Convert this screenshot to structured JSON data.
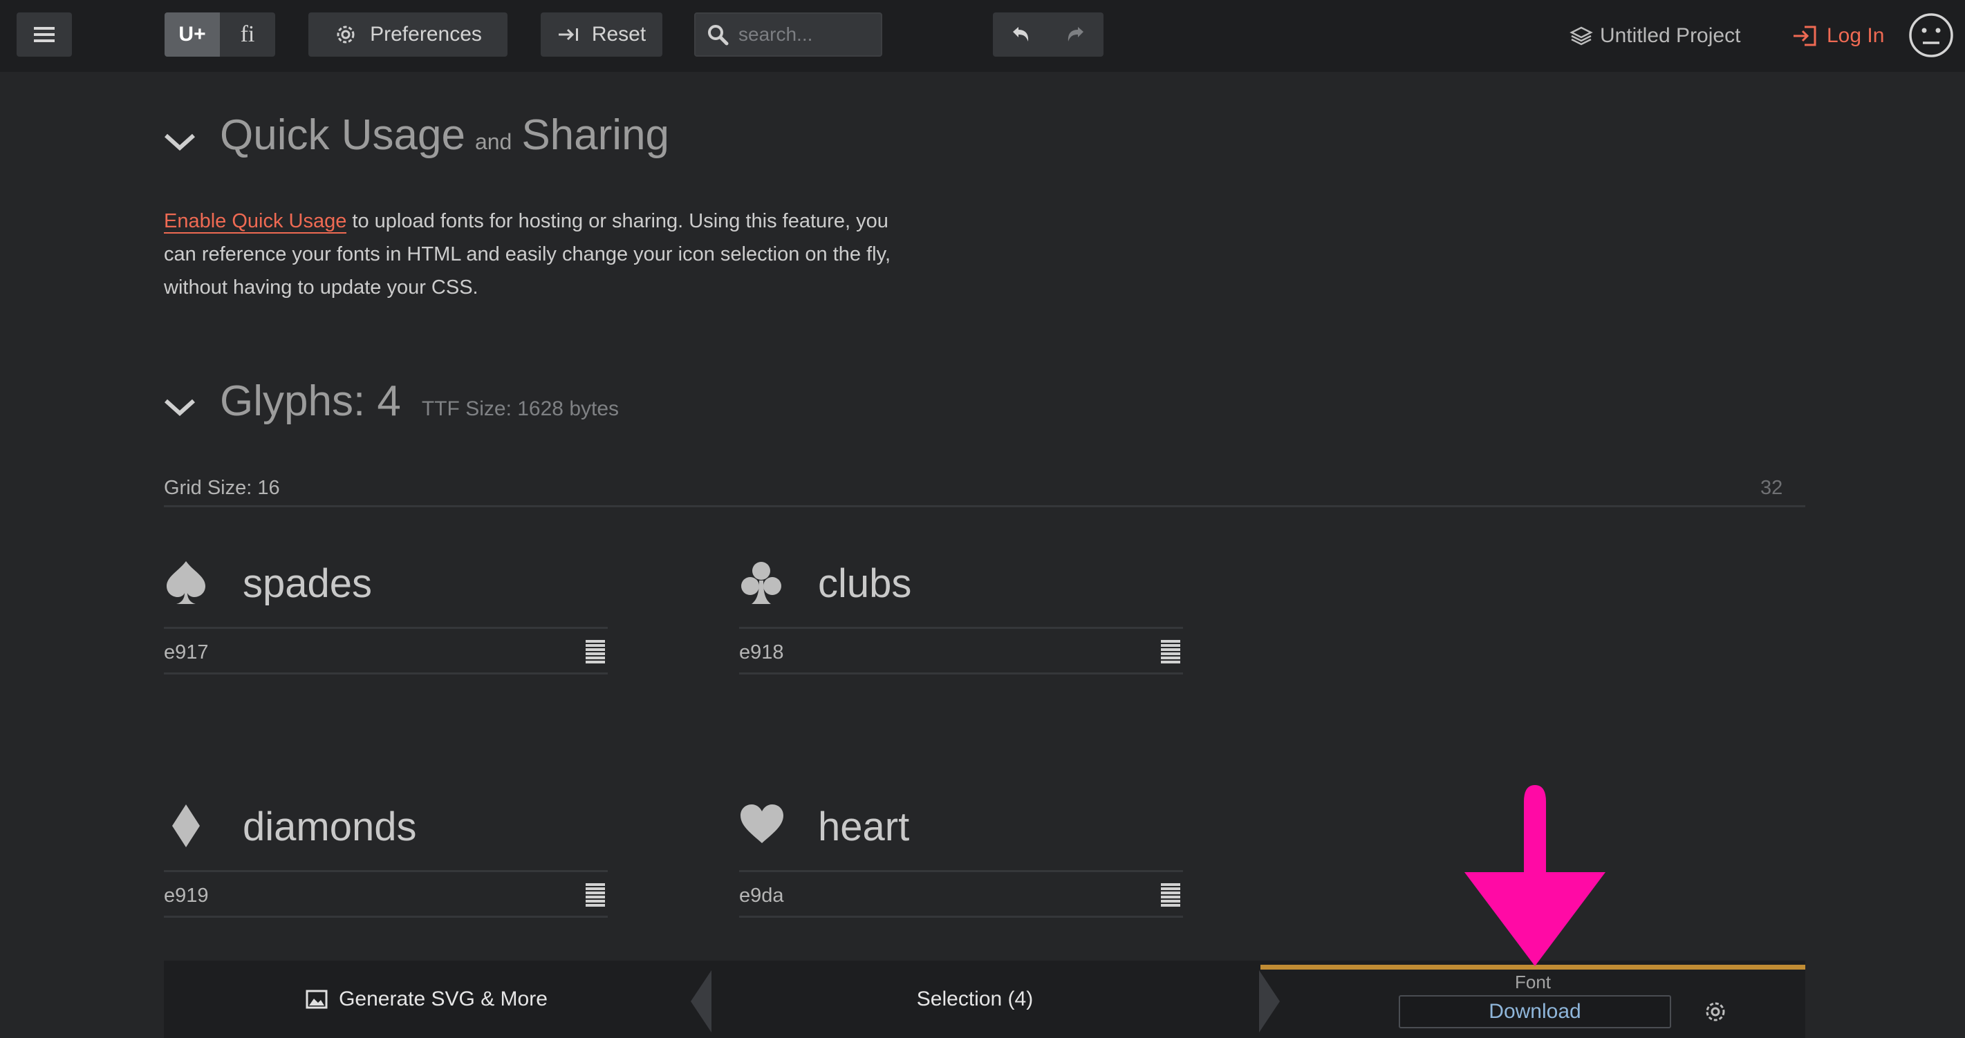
{
  "toolbar": {
    "unicode_label": "U+",
    "ligature_label": "fi",
    "preferences_label": "Preferences",
    "reset_label": "Reset",
    "search_placeholder": "search...",
    "project_title": "Untitled Project",
    "login_label": "Log In"
  },
  "quick_usage": {
    "title_part1": "Quick Usage",
    "title_and": "and",
    "title_part2": "Sharing",
    "link_text": "Enable Quick Usage",
    "body_text": " to upload fonts for hosting or sharing. Using this feature, you can reference your fonts in HTML and easily change your icon selection on the fly, without having to update your CSS."
  },
  "glyphs_section": {
    "title": "Glyphs: 4",
    "ttf_size": "TTF Size: 1628 bytes",
    "grid_size_label": "Grid Size: 16",
    "grid_max": "32",
    "items": [
      {
        "name": "spades",
        "code": "e917",
        "icon": "spades-icon"
      },
      {
        "name": "clubs",
        "code": "e918",
        "icon": "clubs-icon"
      },
      {
        "name": "diamonds",
        "code": "e919",
        "icon": "diamonds-icon"
      },
      {
        "name": "heart",
        "code": "e9da",
        "icon": "heart-icon"
      }
    ]
  },
  "bottombar": {
    "generate_label": "Generate SVG & More",
    "selection_label": "Selection (4)",
    "font_label": "Font",
    "download_label": "Download"
  },
  "colors": {
    "accent_red": "#ef6a53",
    "font_tab_accent": "#c08c34",
    "annotation_arrow": "#ff0aa5"
  }
}
